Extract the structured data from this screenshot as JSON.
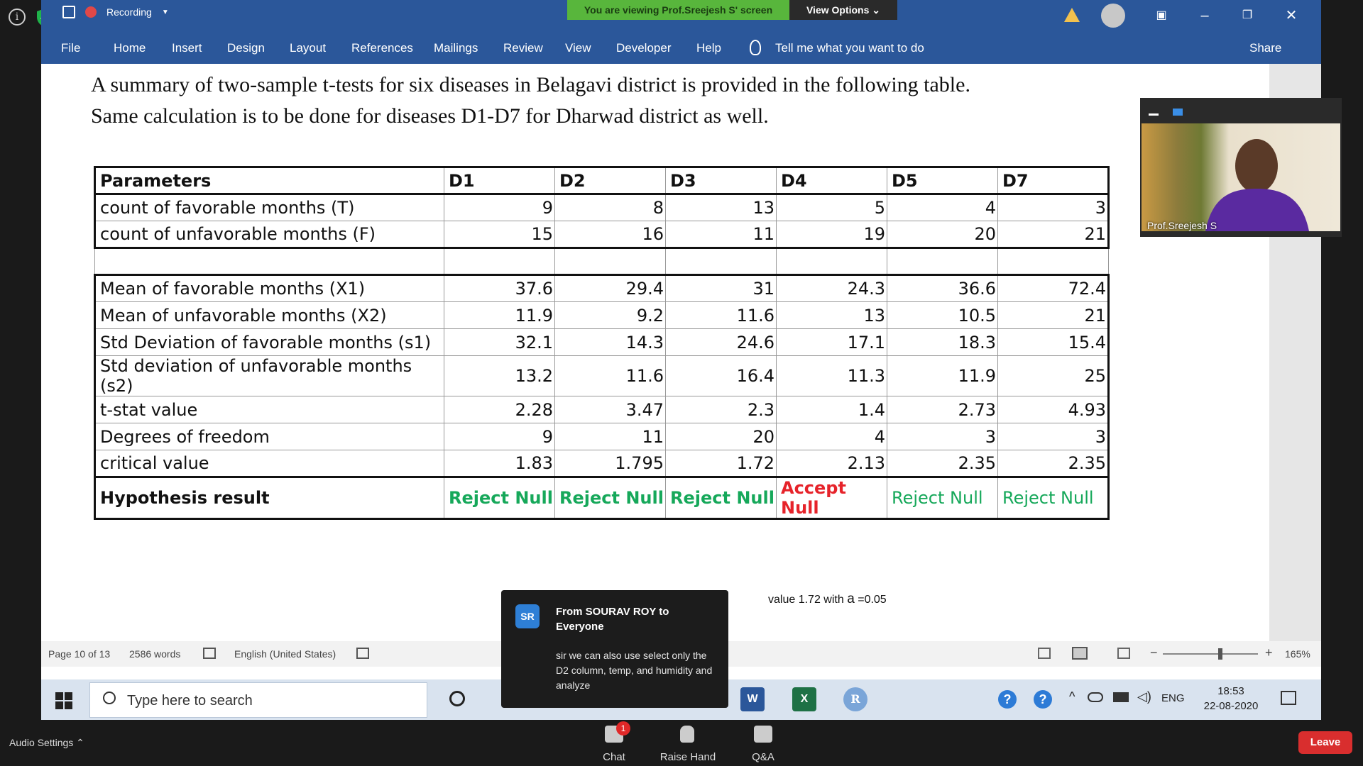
{
  "zoom": {
    "viewing_banner": "You are viewing Prof.Sreejesh S' screen",
    "view_options": "View Options ⌄",
    "recording_label": "Recording",
    "audio_settings": "Audio Settings ⌃",
    "chat_label": "Chat",
    "chat_badge": "1",
    "raise_hand_label": "Raise Hand",
    "qa_label": "Q&A",
    "leave_label": "Leave",
    "presenter_name": "Prof.Sreejesh S"
  },
  "ribbon": {
    "tabs": [
      "File",
      "Home",
      "Insert",
      "Design",
      "Layout",
      "References",
      "Mailings",
      "Review",
      "View",
      "Developer",
      "Help"
    ],
    "tell_me": "Tell me what you want to do",
    "share": "Share"
  },
  "document": {
    "intro_line1": "A summary of two-sample t-tests for six diseases in Belagavi district is provided in the following table.",
    "intro_line2": "Same calculation is to be done for diseases D1-D7 for Dharwad district as well.",
    "partial_text": "value 1.72 with",
    "alpha_symbol": "a",
    "alpha_value": "=0.05"
  },
  "table": {
    "header": [
      "Parameters",
      "D1",
      "D2",
      "D3",
      "D4",
      "D5",
      "D7"
    ],
    "rows_top": [
      [
        "count of favorable months (T)",
        "9",
        "8",
        "13",
        "5",
        "4",
        "3"
      ],
      [
        "count of unfavorable months (F)",
        "15",
        "16",
        "11",
        "19",
        "20",
        "21"
      ]
    ],
    "rows_bottom": [
      [
        "Mean of favorable months (X1)",
        "37.6",
        "29.4",
        "31",
        "24.3",
        "36.6",
        "72.4"
      ],
      [
        "Mean of unfavorable months (X2)",
        "11.9",
        "9.2",
        "11.6",
        "13",
        "10.5",
        "21"
      ],
      [
        "Std Deviation of favorable months (s1)",
        "32.1",
        "14.3",
        "24.6",
        "17.1",
        "18.3",
        "15.4"
      ],
      [
        "Std deviation of unfavorable months (s2)",
        "13.2",
        "11.6",
        "16.4",
        "11.3",
        "11.9",
        "25"
      ],
      [
        "t-stat value",
        "2.28",
        "3.47",
        "2.3",
        "1.4",
        "2.73",
        "4.93"
      ],
      [
        "Degrees of freedom",
        "9",
        "11",
        "20",
        "4",
        "3",
        "3"
      ],
      [
        "critical value",
        "1.83",
        "1.795",
        "1.72",
        "2.13",
        "2.35",
        "2.35"
      ]
    ],
    "result_row": [
      "Hypothesis result",
      "Reject Null",
      "Reject Null",
      "Reject Null",
      "Accept Null",
      "Reject Null",
      "Reject Null"
    ],
    "colors": {
      "reject": "#16a85a",
      "accept": "#e6232a"
    }
  },
  "chat": {
    "avatar": "SR",
    "from": "From SOURAV ROY to Everyone",
    "message": "sir we can also use select only the D2 column, temp, and humidity and analyze"
  },
  "statusbar": {
    "page": "Page 10 of 13",
    "words": "2586 words",
    "language": "English (United States)",
    "zoom": "165%"
  },
  "taskbar": {
    "search_placeholder": "Type here to search",
    "lang": "ENG",
    "time": "18:53",
    "date": "22-08-2020",
    "word_app": "W",
    "excel_app": "X",
    "r_app": "R"
  }
}
